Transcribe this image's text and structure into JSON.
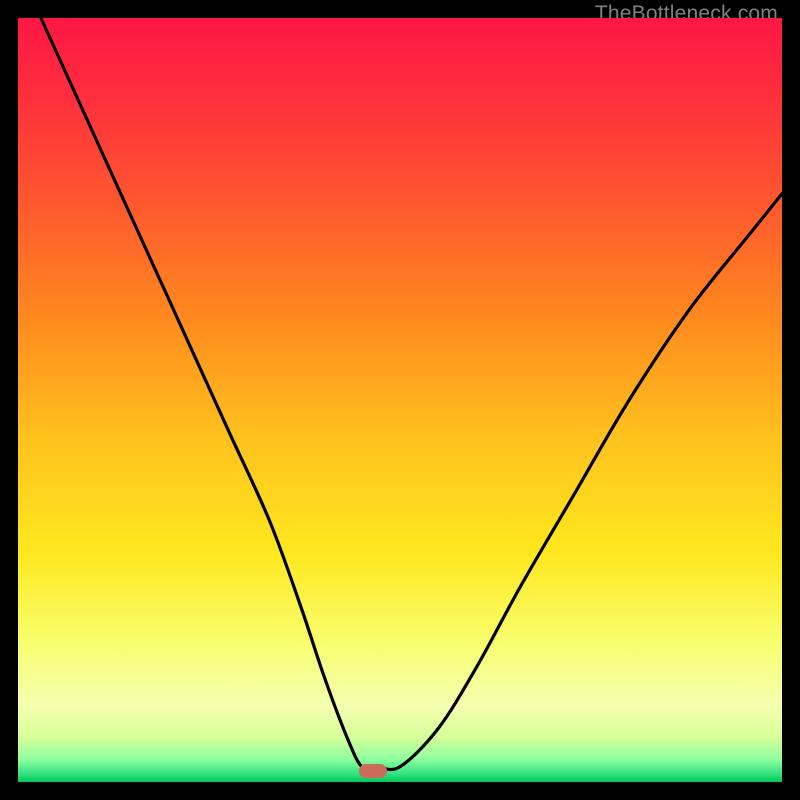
{
  "watermark": "TheBottleneck.com",
  "colors": {
    "gradient_top": "#ff1744",
    "gradient_mid_upper": "#ff6d2a",
    "gradient_mid": "#ffd21e",
    "gradient_lower": "#f8ff70",
    "gradient_band": "#c8ff8a",
    "gradient_bottom_line": "#00e676",
    "curve": "#000000",
    "marker": "#cc6b5a",
    "frame": "#000000"
  },
  "marker": {
    "x_frac": 0.465,
    "y_frac": 0.985
  },
  "chart_data": {
    "type": "line",
    "title": "",
    "xlabel": "",
    "ylabel": "",
    "xlim": [
      0,
      1
    ],
    "ylim": [
      0,
      1
    ],
    "series": [
      {
        "name": "bottleneck-curve",
        "x": [
          0.03,
          0.08,
          0.13,
          0.18,
          0.23,
          0.28,
          0.33,
          0.37,
          0.4,
          0.43,
          0.45,
          0.47,
          0.5,
          0.55,
          0.6,
          0.66,
          0.73,
          0.8,
          0.88,
          0.96,
          1.0
        ],
        "y": [
          1.0,
          0.89,
          0.78,
          0.67,
          0.56,
          0.45,
          0.34,
          0.23,
          0.14,
          0.06,
          0.02,
          0.02,
          0.02,
          0.07,
          0.15,
          0.26,
          0.38,
          0.5,
          0.62,
          0.72,
          0.77
        ]
      }
    ],
    "annotations": [
      {
        "name": "min-marker",
        "x": 0.465,
        "y": 0.015
      }
    ]
  }
}
